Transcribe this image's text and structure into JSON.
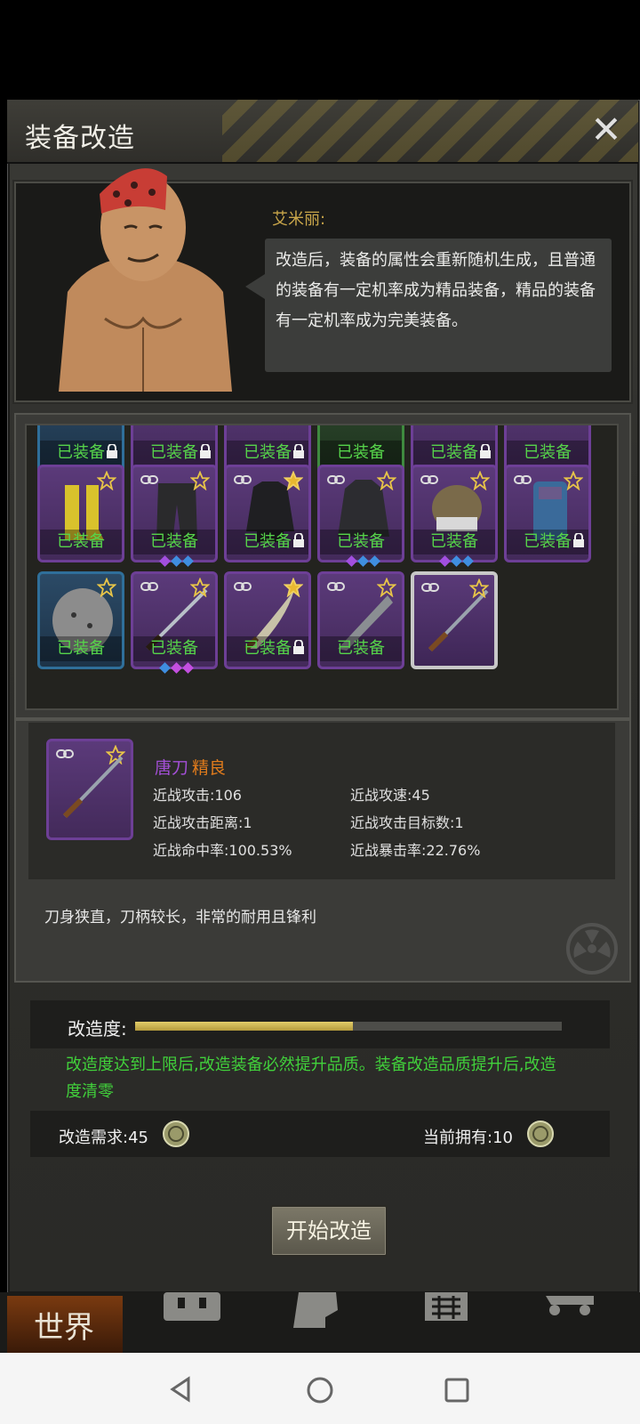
{
  "header": {
    "title": "装备改造"
  },
  "npc": {
    "name": "艾米丽:",
    "dialog": "改造后，装备的属性会重新随机生成，且普通的装备有一定机率成为精品装备，精品的装备有一定机率成为完美装备。"
  },
  "grid": {
    "equipped_label": "已装备",
    "rows": [
      [
        {
          "rarity": "blue",
          "equipped": true,
          "lock": true
        },
        {
          "rarity": "purple",
          "equipped": true,
          "lock": true
        },
        {
          "rarity": "purple",
          "equipped": true,
          "lock": true
        },
        {
          "rarity": "green",
          "equipped": true,
          "lock": false
        },
        {
          "rarity": "purple",
          "equipped": true,
          "lock": true
        },
        {
          "rarity": "purple",
          "equipped": true,
          "lock": false
        }
      ],
      [
        {
          "rarity": "purple",
          "item": "boots-icon",
          "equipped": true,
          "star": "outline",
          "link": false,
          "lock": false,
          "gems": []
        },
        {
          "rarity": "purple",
          "item": "pants-icon",
          "equipped": true,
          "star": "outline",
          "link": true,
          "lock": false,
          "gems": [
            "#a24fe0",
            "#3f8ee0",
            "#3f8ee0"
          ]
        },
        {
          "rarity": "purple",
          "item": "jacket-icon",
          "equipped": true,
          "star": "gold",
          "link": true,
          "lock": true,
          "gems": []
        },
        {
          "rarity": "purple",
          "item": "coat-icon",
          "equipped": true,
          "star": "outline",
          "link": true,
          "lock": false,
          "gems": [
            "#a24fe0",
            "#3f8ee0",
            "#3f8ee0"
          ]
        },
        {
          "rarity": "purple",
          "item": "helmet-icon",
          "equipped": true,
          "star": "outline",
          "link": true,
          "lock": false,
          "gems": [
            "#a24fe0",
            "#3f8ee0",
            "#3f8ee0"
          ]
        },
        {
          "rarity": "purple",
          "item": "backpack-icon",
          "equipped": true,
          "star": "outline",
          "link": true,
          "lock": true,
          "gems": []
        }
      ],
      [
        {
          "rarity": "blue",
          "item": "shield-icon",
          "equipped": true,
          "star": "outline",
          "link": false,
          "lock": false,
          "gems": []
        },
        {
          "rarity": "purple",
          "item": "sword-icon",
          "equipped": true,
          "star": "outline",
          "link": true,
          "lock": false,
          "gems": [
            "#3f8ee0",
            "#c34fe0",
            "#c34fe0"
          ]
        },
        {
          "rarity": "purple",
          "item": "scimitar-icon",
          "equipped": true,
          "star": "gold",
          "link": true,
          "lock": true,
          "gems": []
        },
        {
          "rarity": "purple",
          "item": "machete-icon",
          "equipped": true,
          "star": "outline",
          "link": true,
          "lock": false,
          "gems": []
        },
        {
          "rarity": "purple",
          "item": "katana-icon",
          "equipped": false,
          "star": "outline",
          "link": true,
          "lock": false,
          "gems": [],
          "selected": true
        }
      ]
    ]
  },
  "detail": {
    "name": "唐刀",
    "quality": "精良",
    "stats": [
      {
        "label": "近战攻击:106"
      },
      {
        "label": "近战攻速:45"
      },
      {
        "label": "近战攻击距离:1"
      },
      {
        "label": "近战攻击目标数:1"
      },
      {
        "label": "近战命中率:100.53%"
      },
      {
        "label": "近战暴击率:22.76%"
      }
    ],
    "description": "刀身狭直，刀柄较长，非常的耐用且锋利"
  },
  "reforge": {
    "progress_label": "改造度:",
    "progress_fraction": 0.51,
    "hint": "改造度达到上限后,改造装备必然提升品质。装备改造品质提升后,改造度清零",
    "requirement": "改造需求:45",
    "owned": "当前拥有:10",
    "start_button": "开始改造"
  },
  "bottom_nav": {
    "world_tab": "世界"
  },
  "colors": {
    "equipped_text": "#56d44a",
    "purple_name": "#a34fd6",
    "quality_orange": "#e07b1c",
    "hint_green": "#41d13b",
    "npc_name": "#c9a64a"
  }
}
